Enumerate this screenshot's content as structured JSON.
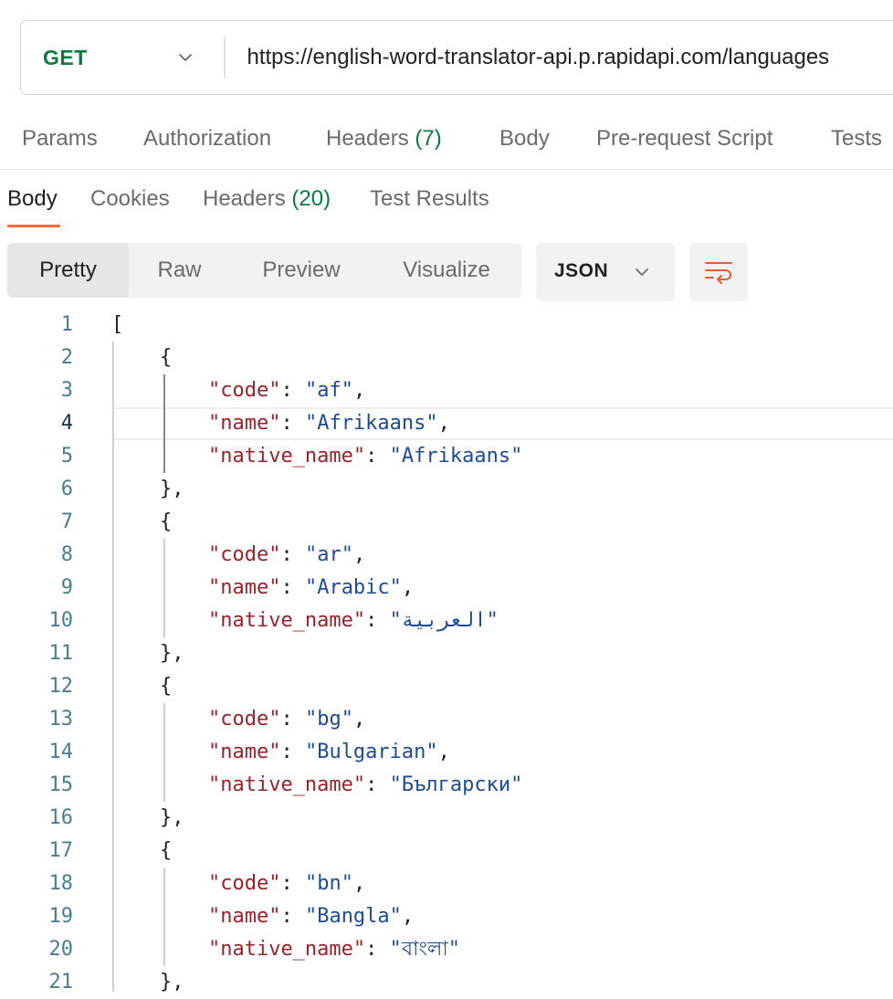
{
  "request": {
    "method": "GET",
    "url": "https://english-word-translator-api.p.rapidapi.com/languages"
  },
  "request_tabs": [
    {
      "label": "Params",
      "count": ""
    },
    {
      "label": "Authorization",
      "count": ""
    },
    {
      "label": "Headers",
      "count": "(7)"
    },
    {
      "label": "Body",
      "count": ""
    },
    {
      "label": "Pre-request Script",
      "count": ""
    },
    {
      "label": "Tests",
      "count": ""
    }
  ],
  "response_tabs": [
    {
      "label": "Body",
      "count": ""
    },
    {
      "label": "Cookies",
      "count": ""
    },
    {
      "label": "Headers",
      "count": "(20)"
    },
    {
      "label": "Test Results",
      "count": ""
    }
  ],
  "view_modes": [
    "Pretty",
    "Raw",
    "Preview",
    "Visualize"
  ],
  "format": "JSON",
  "icons": {
    "method_dropdown": "chevron-down-icon",
    "format_dropdown": "chevron-down-icon",
    "wrap": "wrap-lines-icon"
  },
  "colors": {
    "method": "#0b7a3e",
    "count": "#0b7a3e",
    "active_underline": "#ff6c37",
    "json_key": "#9b2128",
    "json_string": "#1d4b94",
    "line_number": "#4a7d8d"
  },
  "code": {
    "current_line": 4,
    "lines": [
      {
        "n": "1",
        "text": "["
      },
      {
        "n": "2",
        "text": "    {"
      },
      {
        "n": "3",
        "key": "\"code\"",
        "value": "\"af\"",
        "end": ","
      },
      {
        "n": "4",
        "key": "\"name\"",
        "value": "\"Afrikaans\"",
        "end": ","
      },
      {
        "n": "5",
        "key": "\"native_name\"",
        "value": "\"Afrikaans\"",
        "end": ""
      },
      {
        "n": "6",
        "text": "    },"
      },
      {
        "n": "7",
        "text": "    {"
      },
      {
        "n": "8",
        "key": "\"code\"",
        "value": "\"ar\"",
        "end": ","
      },
      {
        "n": "9",
        "key": "\"name\"",
        "value": "\"Arabic\"",
        "end": ","
      },
      {
        "n": "10",
        "key": "\"native_name\"",
        "value": "\"العربية\"",
        "end": ""
      },
      {
        "n": "11",
        "text": "    },"
      },
      {
        "n": "12",
        "text": "    {"
      },
      {
        "n": "13",
        "key": "\"code\"",
        "value": "\"bg\"",
        "end": ","
      },
      {
        "n": "14",
        "key": "\"name\"",
        "value": "\"Bulgarian\"",
        "end": ","
      },
      {
        "n": "15",
        "key": "\"native_name\"",
        "value": "\"Български\"",
        "end": ""
      },
      {
        "n": "16",
        "text": "    },"
      },
      {
        "n": "17",
        "text": "    {"
      },
      {
        "n": "18",
        "key": "\"code\"",
        "value": "\"bn\"",
        "end": ","
      },
      {
        "n": "19",
        "key": "\"name\"",
        "value": "\"Bangla\"",
        "end": ","
      },
      {
        "n": "20",
        "key": "\"native_name\"",
        "value": "\"বাংলা\"",
        "end": ""
      },
      {
        "n": "21",
        "text": "    },"
      }
    ]
  }
}
